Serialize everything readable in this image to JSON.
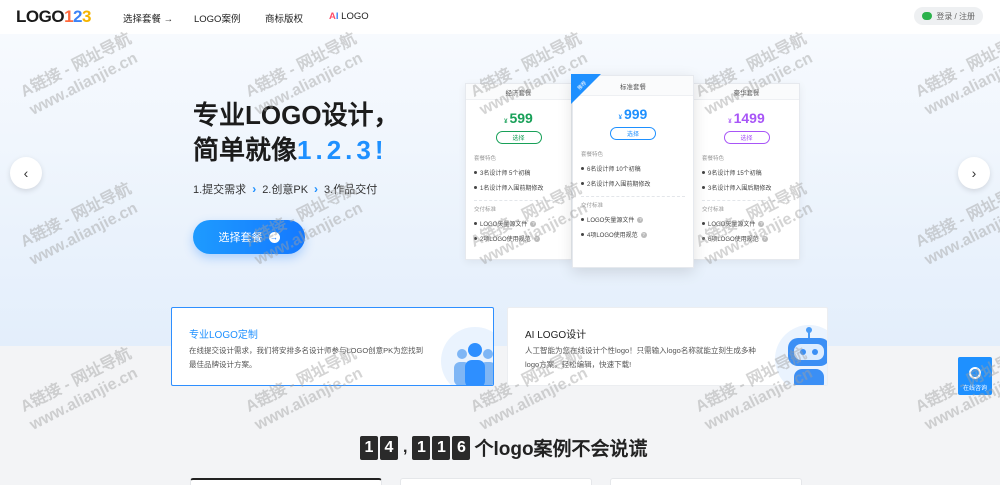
{
  "header": {
    "logo": {
      "text": "LOGO",
      "n1": "1",
      "n2": "2",
      "n3": "3"
    },
    "nav": [
      {
        "label": "选择套餐 →"
      },
      {
        "label": "LOGO案例"
      },
      {
        "label": "商标版权"
      }
    ],
    "nav_ai": {
      "a": "A",
      "i": "I",
      "rest": " LOGO"
    },
    "login": "登录 / 注册"
  },
  "hero": {
    "title_line1": "专业LOGO设计，",
    "title_line2_prefix": "简单就像",
    "title_line2_accent": "1.2.3!",
    "steps": [
      "1.提交需求",
      "2.创意PK",
      "3.作品交付"
    ],
    "cta": "选择套餐",
    "prev": "‹",
    "next": "›"
  },
  "pricing": [
    {
      "name": "经济套餐",
      "currency": "¥",
      "price": "599",
      "select": "选择",
      "section1": "套餐特色",
      "features1": [
        "3名设计师 5个初稿",
        "1名设计师入围前期修改"
      ],
      "section2": "交付标准",
      "features2": [
        "LOGO矢量源文件",
        "2项LOGO使用规范"
      ]
    },
    {
      "name": "标准套餐",
      "ribbon": "推荐",
      "currency": "¥",
      "price": "999",
      "select": "选择",
      "section1": "套餐特色",
      "features1": [
        "6名设计师 10个初稿",
        "2名设计师入围前期修改"
      ],
      "section2": "交付标准",
      "features2": [
        "LOGO矢量源文件",
        "4项LOGO使用规范"
      ]
    },
    {
      "name": "豪华套餐",
      "currency": "¥",
      "price": "1499",
      "select": "选择",
      "section1": "套餐特色",
      "features1": [
        "9名设计师 15个初稿",
        "3名设计师入围后期修改"
      ],
      "section2": "交付标准",
      "features2": [
        "LOGO矢量源文件",
        "6项LOGO使用规范"
      ]
    }
  ],
  "features": [
    {
      "title": "专业LOGO定制",
      "desc": "在线提交设计需求，我们将安排多名设计师参与LOGO创意PK为您找到最佳品牌设计方案。"
    },
    {
      "title": "AI LOGO设计",
      "desc": "人工智能为您在线设计个性logo！只需输入logo名称就能立刻生成多种logo方案，轻松编辑，快速下载!"
    }
  ],
  "service": "在线咨询",
  "counter": {
    "d1": "1",
    "d2": "4",
    "comma": ",",
    "d3": "1",
    "d4": "1",
    "d5": "6",
    "suffix": "个logo案例不会说谎"
  },
  "watermark": {
    "line1": "A链接 - 网址导航",
    "line2": "www.alianjie.cn"
  },
  "colors": {
    "accent": "#1e90ff",
    "price1": "#18a058",
    "price2": "#1e90ff",
    "price3": "#a855f7"
  }
}
